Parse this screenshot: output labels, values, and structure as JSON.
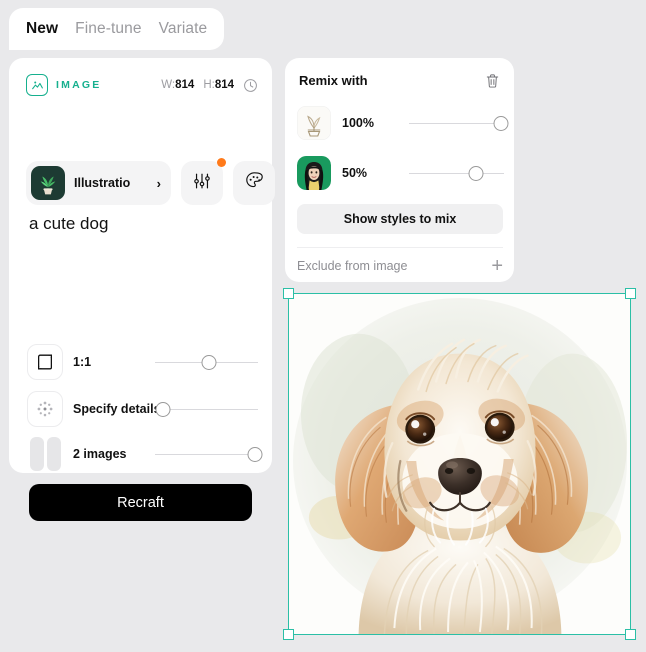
{
  "tabs": [
    {
      "label": "New",
      "active": true
    },
    {
      "label": "Fine-tune",
      "active": false
    },
    {
      "label": "Variate",
      "active": false
    }
  ],
  "left_panel": {
    "header": {
      "badge_icon": "image-icon",
      "label": "IMAGE",
      "width_key": "W:",
      "width_value": "814",
      "height_key": "H:",
      "height_value": "814",
      "history_icon": "clock-icon"
    },
    "style": {
      "thumb_icon": "plant-thumbnail",
      "name": "Illustratio",
      "chevron": "›",
      "settings_icon": "sliders-icon",
      "settings_badge": true,
      "palette_icon": "palette-icon"
    },
    "prompt": "a cute dog",
    "options": [
      {
        "name": "aspect-ratio",
        "icon": "crop-icon",
        "label": "1:1",
        "slider_pct": 52
      },
      {
        "name": "specify-details",
        "icon": "dots-circle-icon",
        "label": "Specify details",
        "slider_pct": 2
      },
      {
        "name": "image-count",
        "icon": "two-images-icon",
        "label": "2 images",
        "slider_pct": 98
      }
    ],
    "recraft_label": "Recraft"
  },
  "remix_panel": {
    "title": "Remix with",
    "delete_icon": "trash-icon",
    "items": [
      {
        "thumb": "plant-sketch-thumbnail",
        "percent": "100%",
        "slider_pct": 98
      },
      {
        "thumb": "woman-portrait-thumbnail",
        "percent": "50%",
        "slider_pct": 70
      }
    ],
    "show_styles_label": "Show styles to mix",
    "exclude_label": "Exclude from image",
    "exclude_add_icon": "plus-icon"
  },
  "canvas": {
    "image_alt": "watercolor portrait of a cute cream and apricot colored puppy",
    "selection_color": "#2bbfa6",
    "handles": [
      "top-left",
      "top-right",
      "bottom-left",
      "bottom-right"
    ]
  },
  "colors": {
    "accent_teal": "#16b08e",
    "selection_teal": "#2bbfa6",
    "badge_orange": "#ff7a1a",
    "page_background": "#e9e9eb",
    "panel_background": "#ffffff",
    "button_black": "#000000"
  }
}
